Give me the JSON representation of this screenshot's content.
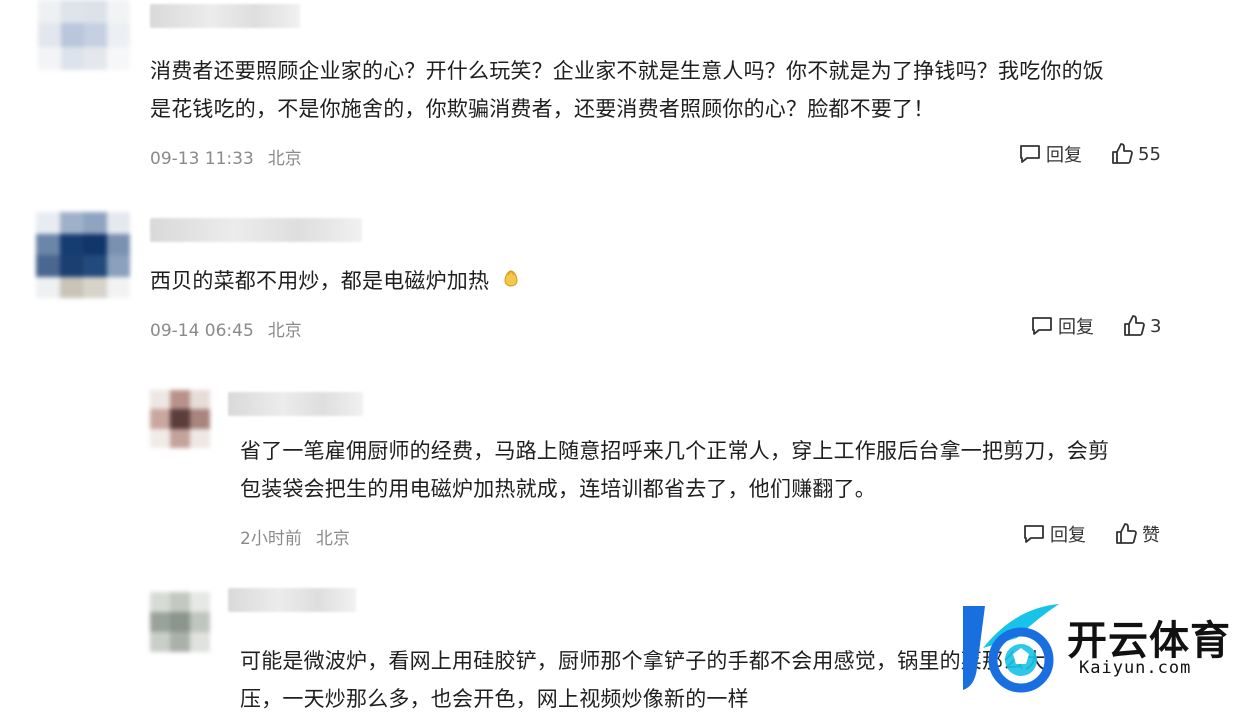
{
  "comments": [
    {
      "text_lines": [
        "消费者还要照顾企业家的心？开什么玩笑？企业家不就是生意人吗？你不就是为了挣钱吗？我吃你的饭",
        "是花钱吃的，不是你施舍的，你欺骗消费者，还要消费者照顾你的心？脸都不要了！"
      ],
      "time": "09-13 11:33",
      "location": "北京",
      "reply_label": "回复",
      "likes": "55"
    },
    {
      "text_lines": [
        "西贝的菜都不用炒，都是电磁炉加热"
      ],
      "time": "09-14 06:45",
      "location": "北京",
      "reply_label": "回复",
      "likes": "3"
    },
    {
      "text_lines": [
        "省了一笔雇佣厨师的经费，马路上随意招呼来几个正常人，穿上工作服后台拿一把剪刀，会剪",
        "包装袋会把生的用电磁炉加热就成，连培训都省去了，他们赚翻了。"
      ],
      "time": "2小时前",
      "location": "北京",
      "reply_label": "回复",
      "likes": "赞"
    },
    {
      "text_lines": [
        "可能是微波炉，看网上用硅胶铲，厨师那个拿铲子的手都不会用感觉，锅里的菜那么大",
        "压，一天炒那么多，也会开色，网上视频炒像新的一样"
      ],
      "time": "",
      "location": "",
      "reply_label": "",
      "likes": ""
    }
  ],
  "icons": {
    "reply": "comment-bubble-icon",
    "like": "thumbs-up-icon",
    "emoji": "hands-emoji-icon"
  },
  "watermark": {
    "cn": "开云体育",
    "en": "Kaiyun.com"
  },
  "colors": {
    "text": "#1f1f1f",
    "meta": "#8a8a8a",
    "logo_blue": "#1a6fe0",
    "logo_cyan": "#17c3e8"
  }
}
